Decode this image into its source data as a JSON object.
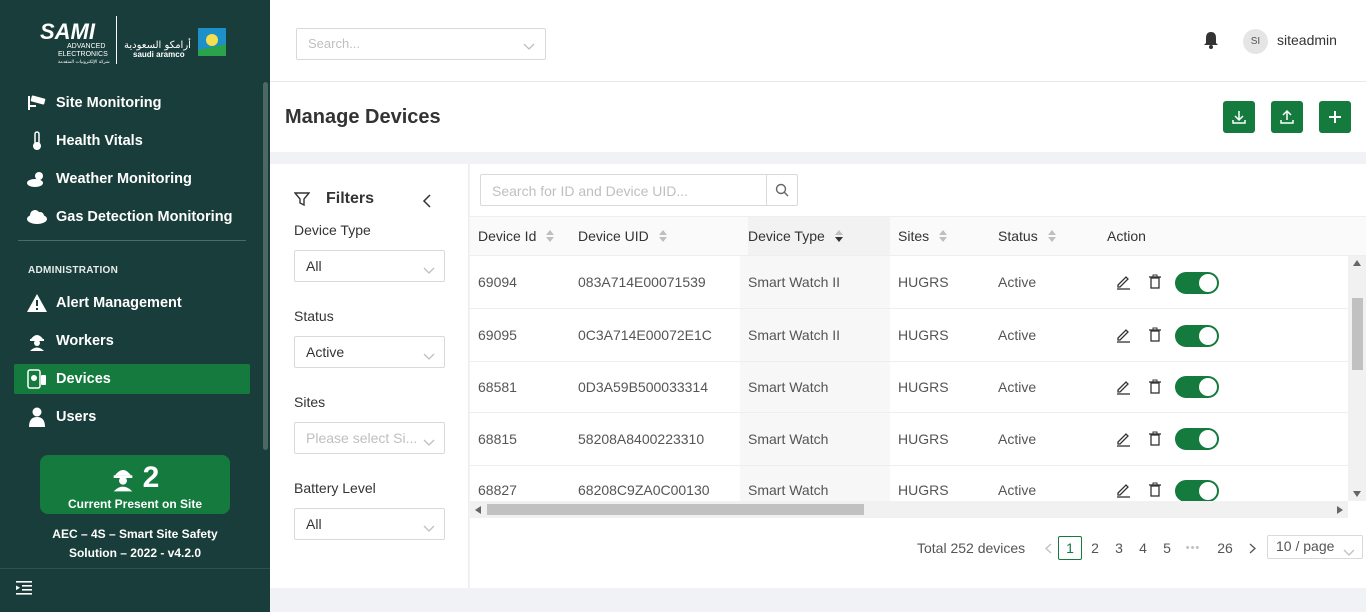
{
  "brand": {
    "name": "SAMI",
    "sub_line1": "ADVANCED",
    "sub_line2": "ELECTRONICS",
    "sub_arabic": "شركة الإلكترونيات المتقدمة",
    "partner_arabic": "أرامكو السعودية",
    "partner": "saudi aramco"
  },
  "sidebar": {
    "items": [
      {
        "label": "Site Monitoring",
        "icon": "cctv-icon"
      },
      {
        "label": "Health Vitals",
        "icon": "thermometer-icon"
      },
      {
        "label": "Weather Monitoring",
        "icon": "weather-icon"
      },
      {
        "label": "Gas Detection Monitoring",
        "icon": "gas-cloud-icon"
      }
    ],
    "section_label": "ADMINISTRATION",
    "admin_items": [
      {
        "label": "Alert Management",
        "icon": "warning-icon"
      },
      {
        "label": "Workers",
        "icon": "worker-icon"
      },
      {
        "label": "Devices",
        "icon": "device-icon",
        "active": true
      },
      {
        "label": "Users",
        "icon": "user-icon"
      }
    ],
    "present_count": "2",
    "present_label": "Current Present on Site",
    "version_line1": "AEC – 4S – Smart Site Safety",
    "version_line2": "Solution – 2022 - v4.2.0"
  },
  "header": {
    "search_placeholder": "Search...",
    "avatar_initials": "SI",
    "username": "siteadmin"
  },
  "page": {
    "title": "Manage Devices"
  },
  "filters": {
    "title": "Filters",
    "device_type_label": "Device Type",
    "device_type_value": "All",
    "status_label": "Status",
    "status_value": "Active",
    "sites_label": "Sites",
    "sites_placeholder": "Please select Si...",
    "battery_label": "Battery Level",
    "battery_value": "All"
  },
  "table": {
    "search_placeholder": "Search for ID and Device UID...",
    "columns": [
      "Device Id",
      "Device UID",
      "Device Type",
      "Sites",
      "Status",
      "Action"
    ],
    "rows": [
      {
        "id": "69094",
        "uid": "083A714E00071539",
        "type": "Smart Watch II",
        "site": "HUGRS",
        "status": "Active",
        "enabled": true
      },
      {
        "id": "69095",
        "uid": "0C3A714E00072E1C",
        "type": "Smart Watch II",
        "site": "HUGRS",
        "status": "Active",
        "enabled": true
      },
      {
        "id": "68581",
        "uid": "0D3A59B500033314",
        "type": "Smart Watch",
        "site": "HUGRS",
        "status": "Active",
        "enabled": true
      },
      {
        "id": "68815",
        "uid": "58208A8400223310",
        "type": "Smart Watch",
        "site": "HUGRS",
        "status": "Active",
        "enabled": true
      },
      {
        "id": "68827",
        "uid": "68208C9ZA0C00130",
        "type": "Smart Watch",
        "site": "HUGRS",
        "status": "Active",
        "enabled": true
      }
    ]
  },
  "pagination": {
    "total": "Total 252 devices",
    "pages": [
      "1",
      "2",
      "3",
      "4",
      "5"
    ],
    "ellipsis": "•••",
    "last_page": "26",
    "current": "1",
    "page_size": "10 / page"
  },
  "colors": {
    "sidebar_bg": "#193d3a",
    "accent": "#147a3e"
  }
}
